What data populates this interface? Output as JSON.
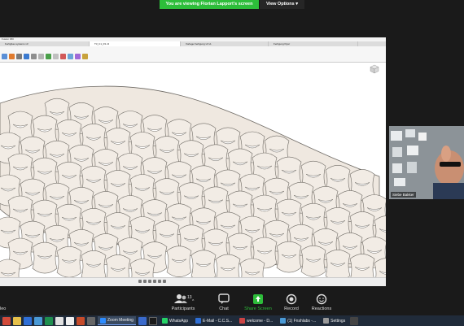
{
  "banner": {
    "viewing_text": "You are viewing Florian Lapport's screen",
    "view_options_label": "View Options"
  },
  "shared_window": {
    "tabs": [
      "Fusion 360",
      "Fertigbau systems v3",
      "T3_C1_03 v3",
      "Vorlage Fertigung v3 v1",
      "Fertigung Flyer"
    ]
  },
  "participant": {
    "name": "Siebe Bakker"
  },
  "meeting_controls": {
    "participants_label": "Participants",
    "participants_count": "13",
    "chat_label": "Chat",
    "share_screen_label": "Share Screen",
    "record_label": "Record",
    "reactions_label": "Reactions",
    "left_partial_label": "leo"
  },
  "taskbar": {
    "tasks": [
      {
        "label": "Zoom Meeting",
        "active": true
      },
      {
        "label": "WhatsApp",
        "active": false
      },
      {
        "label": "E-Mail - C.C.S...",
        "active": false
      },
      {
        "label": "welcome - D...",
        "active": false
      },
      {
        "label": "(1) Fnshlabs -...",
        "active": false
      },
      {
        "label": "Settings",
        "active": false
      }
    ]
  },
  "colors": {
    "banner_green": "#2dbd3a",
    "share_screen_green": "#2dbd3a",
    "taskbar_bg": "#202b3a",
    "tile_fill": "#efe8e0",
    "tile_stroke": "#6e6a64"
  }
}
